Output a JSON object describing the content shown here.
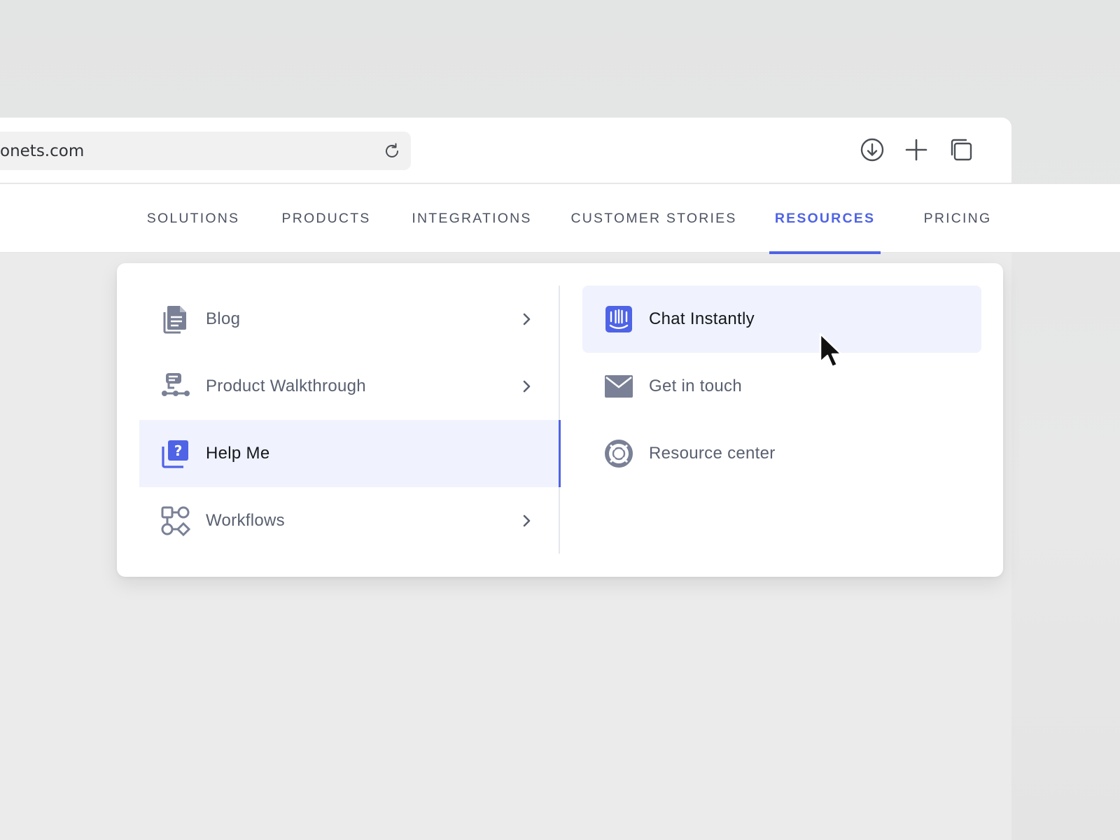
{
  "browser": {
    "address_text": "onets.com",
    "icons": {
      "reload": "reload-icon",
      "download": "download-icon",
      "new_tab": "plus-icon",
      "tabs": "tabs-overview-icon"
    }
  },
  "nav": {
    "items": [
      {
        "label": "SOLUTIONS"
      },
      {
        "label": "PRODUCTS"
      },
      {
        "label": "INTEGRATIONS"
      },
      {
        "label": "CUSTOMER STORIES"
      },
      {
        "label": "RESOURCES",
        "active": true
      },
      {
        "label": "PRICING"
      }
    ],
    "accent_color": "#4f63e6"
  },
  "dropdown": {
    "left_items": [
      {
        "label": "Blog",
        "icon": "document-icon",
        "has_submenu": true
      },
      {
        "label": "Product Walkthrough",
        "icon": "walkthrough-icon",
        "has_submenu": true
      },
      {
        "label": "Help Me",
        "icon": "help-icon",
        "has_submenu": false,
        "active": true
      },
      {
        "label": "Workflows",
        "icon": "workflow-icon",
        "has_submenu": true
      }
    ],
    "right_items": [
      {
        "label": "Chat Instantly",
        "icon": "chat-icon",
        "active": true
      },
      {
        "label": "Get in touch",
        "icon": "envelope-icon"
      },
      {
        "label": "Resource center",
        "icon": "lifebuoy-icon"
      }
    ],
    "highlight_color": "#f0f2fd",
    "icon_color": "#7a8196"
  }
}
